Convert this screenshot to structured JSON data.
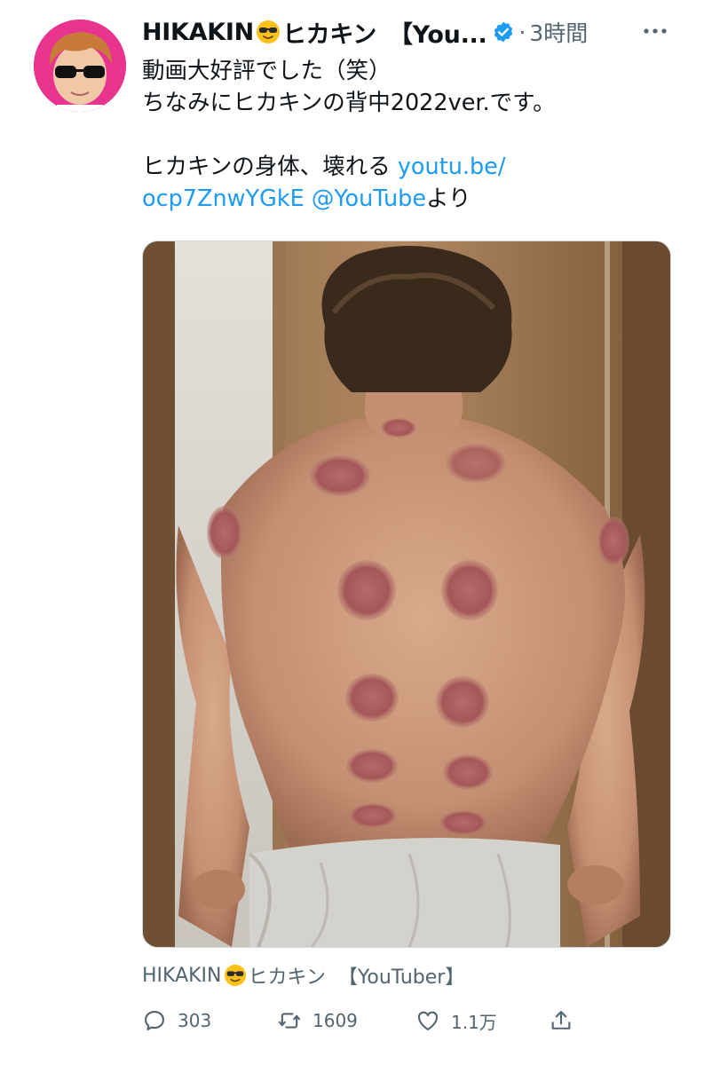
{
  "tweet": {
    "author_name": "HIKAKIN",
    "author_kana": "ヒカキン",
    "author_suffix": "【You...",
    "separator": "·",
    "time": "3時間",
    "text": {
      "line1": "動画大好評でした（笑）",
      "line2": "ちなみにヒカキンの背中2022ver.です。",
      "line3_text": "ヒカキンの身体、壊れる ",
      "line3_link": "youtu.be/",
      "line4_link": "ocp7ZnwYGkE",
      "line4_mention": "@YouTube",
      "line4_tail": "より"
    },
    "quoted_author": {
      "name": "HIKAKIN",
      "kana": "ヒカキン",
      "tag": "【YouTuber】"
    },
    "stats": {
      "replies": "303",
      "retweets": "1609",
      "likes": "1.1万"
    }
  },
  "icons": {
    "verified": "verified-badge-icon",
    "more": "more-options-icon",
    "reply": "reply-icon",
    "retweet": "retweet-icon",
    "like": "heart-icon",
    "share": "share-icon",
    "emoji": "sunglasses-emoji"
  },
  "colors": {
    "link": "#1d9bf0",
    "secondary_text": "#536471",
    "avatar_bg": "#e8338f"
  }
}
